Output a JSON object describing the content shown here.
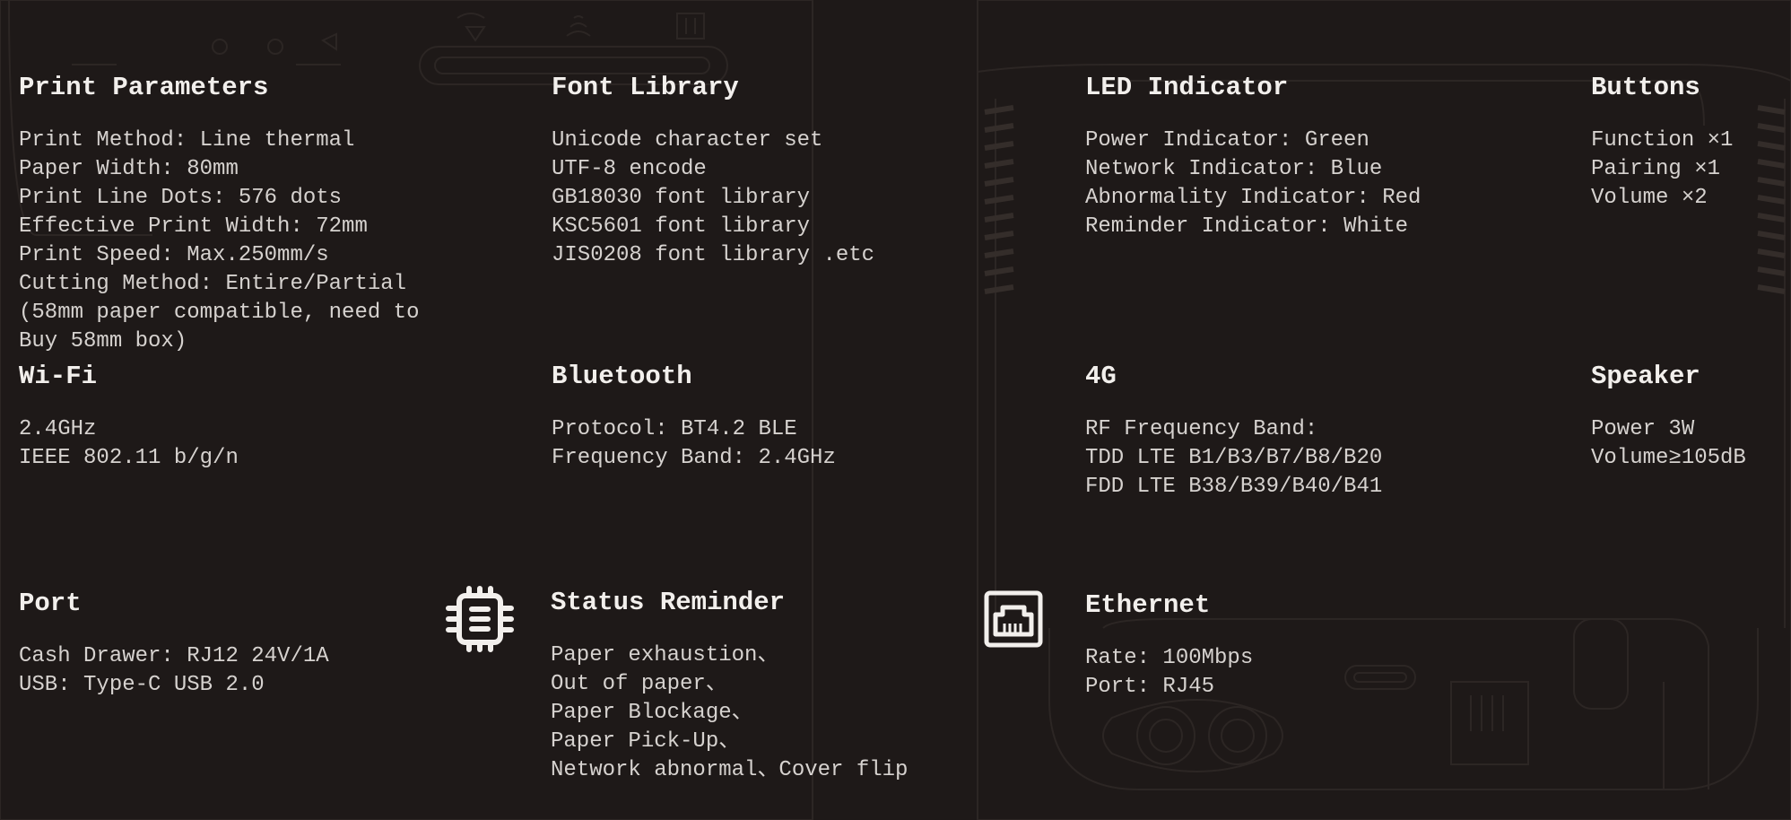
{
  "print_parameters": {
    "title": "Print Parameters",
    "lines": [
      "Print Method: Line thermal",
      "Paper Width: 80mm",
      "Print Line Dots: 576 dots",
      "Effective Print Width: 72mm",
      "Print Speed: Max.250mm/s",
      "Cutting Method: Entire/Partial",
      "(58mm paper compatible, need to",
      "Buy 58mm box)"
    ]
  },
  "font_library": {
    "title": "Font Library",
    "lines": [
      "Unicode character set",
      "UTF-8 encode",
      "GB18030 font library",
      "KSC5601 font library",
      "JIS0208 font library .etc"
    ]
  },
  "led_indicator": {
    "title": "LED Indicator",
    "lines": [
      "Power Indicator: Green",
      "Network Indicator: Blue",
      "Abnormality Indicator: Red",
      "Reminder Indicator: White"
    ]
  },
  "buttons": {
    "title": "Buttons",
    "lines": [
      "Function ×1",
      "Pairing ×1",
      "Volume ×2"
    ]
  },
  "wifi": {
    "title": "Wi-Fi",
    "lines": [
      "2.4GHz",
      "IEEE 802.11 b/g/n"
    ]
  },
  "bluetooth": {
    "title": "Bluetooth",
    "lines": [
      "Protocol: BT4.2 BLE",
      "Frequency Band: 2.4GHz"
    ]
  },
  "lte": {
    "title": "4G",
    "lines": [
      "RF Frequency Band:",
      "TDD LTE B1/B3/B7/B8/B20",
      "FDD LTE B38/B39/B40/B41"
    ]
  },
  "speaker": {
    "title": "Speaker",
    "lines": [
      "Power 3W",
      "Volume≥105dB"
    ]
  },
  "port": {
    "title": "Port",
    "lines": [
      "Cash Drawer: RJ12 24V/1A",
      "USB: Type-C USB 2.0"
    ]
  },
  "status_reminder": {
    "title": "Status Reminder",
    "icon": "chip-icon",
    "lines": [
      "Paper exhaustion、",
      "Out of paper、",
      "Paper Blockage、",
      "Paper Pick-Up、",
      "Network abnormal、Cover flip"
    ]
  },
  "ethernet": {
    "title": "Ethernet",
    "icon": "ethernet-port-icon",
    "lines": [
      "Rate: 100Mbps",
      "Port: RJ45"
    ]
  }
}
